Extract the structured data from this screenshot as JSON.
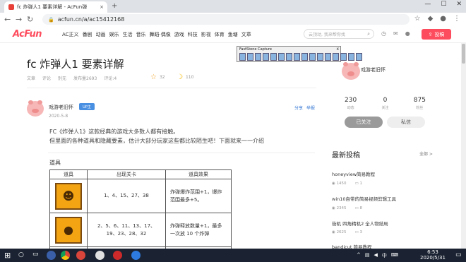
{
  "browser": {
    "tab_title": "fc 炸弹人1 要素详解 - AcFun弹",
    "tab_close": "×",
    "new_tab": "+",
    "url": "acfun.cn/a/ac15412168",
    "window_controls": [
      "—",
      "☐",
      "✕"
    ]
  },
  "site": {
    "logo": "AcFun",
    "nav": [
      "AC正义",
      "番剧",
      "动画",
      "娱乐",
      "生活",
      "音乐",
      "舞蹈·偶像",
      "游戏",
      "科技",
      "影视",
      "体育",
      "鱼塘",
      "文章"
    ],
    "search_placeholder": "云顶动, 我来帮你找",
    "contribute_label": "投稿"
  },
  "article": {
    "title": "fc  炸弹人1  要素详解",
    "meta": [
      "文章",
      "评论",
      "别无",
      "发布量2693",
      "评论:4"
    ],
    "likes": "32",
    "coins": "110",
    "author": "戏游老旧怀",
    "up_badge": "UP主",
    "date": "2020-5-8",
    "share_label": "分享",
    "report_label": "举报",
    "paragraph1": "FC《炸弹人1》这款经典的游戏大多数人都有接触。",
    "paragraph2": "但里面的各种道具和隐藏要素，估计大部分玩家这些都比较陌生吧！下面就来一一介绍",
    "section_heading": "道具",
    "table": {
      "headers": [
        "道具",
        "出现关卡",
        "道具效果"
      ],
      "rows": [
        {
          "icon": "face-item-icon",
          "stages_line1": "1、4、15、27、38",
          "stages_line2": "",
          "effect_line1": "炸弹爆炸范围+1，爆炸",
          "effect_line2": "范围最多+5。"
        },
        {
          "icon": "bomb-item-icon",
          "stages_line1": "2、5、6、11、13、17、",
          "stages_line2": "19、23、28、32",
          "effect_line1": "炸弹释放数量+1，最多",
          "effect_line2": "一次放 10 个炸弹"
        }
      ]
    }
  },
  "sidebar": {
    "name": "戏游老旧怀",
    "stats": [
      {
        "number": "230",
        "label": "动态"
      },
      {
        "number": "0",
        "label": "关注"
      },
      {
        "number": "875",
        "label": "粉丝"
      }
    ],
    "follow_label": "已关注",
    "message_label": "私信",
    "recent_title": "最新投稿",
    "all_label": "全部 >",
    "recent": [
      {
        "title": "honeyview简易教程",
        "views": "1450",
        "comments": "1"
      },
      {
        "title": "win10自带的简易视频剪辑工具",
        "views": "2345",
        "comments": "8"
      },
      {
        "title": "街机  四角精机2  全人物結局",
        "views": "2625",
        "comments": "3"
      },
      {
        "title": "bandicut  简易教程",
        "views": "",
        "comments": ""
      }
    ]
  },
  "capture_bar": {
    "title": "FastStone Capture",
    "close": "x"
  },
  "taskbar": {
    "ime": "中",
    "time": "6:53",
    "date": "2020/5/31"
  }
}
